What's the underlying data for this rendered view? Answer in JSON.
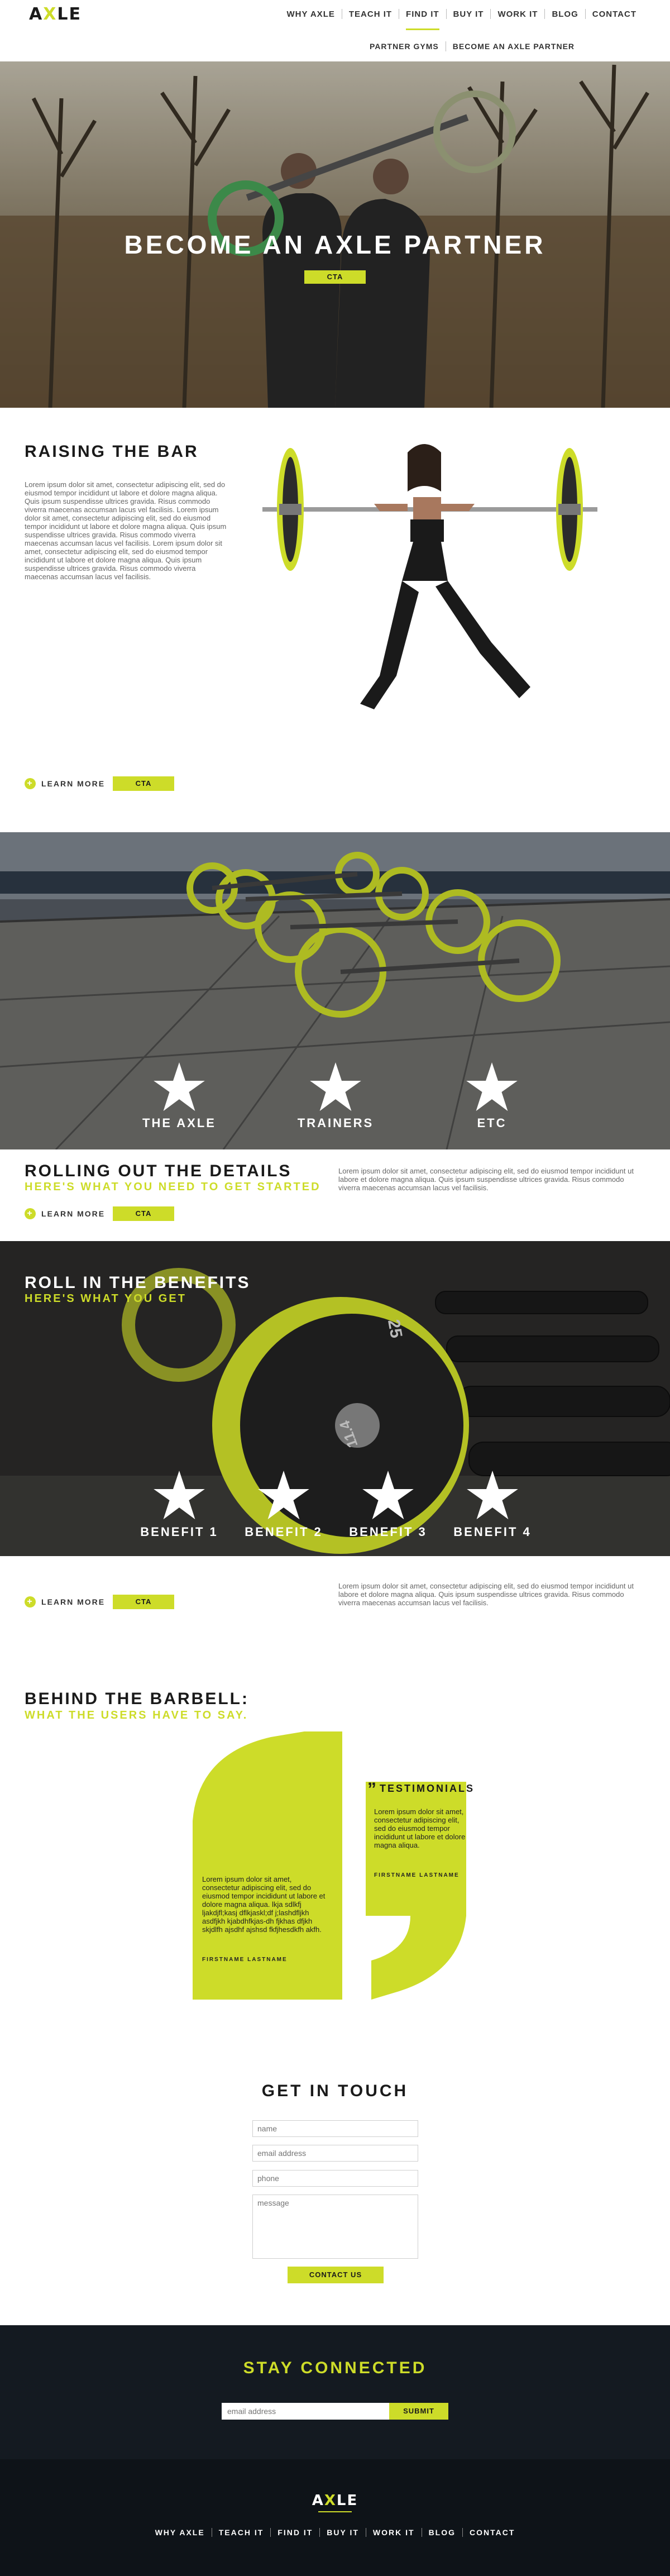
{
  "brand": {
    "logo_prefix": "A",
    "logo_x": "X",
    "logo_suffix": "LE",
    "accent": "#cddc29",
    "dark": "#141a21"
  },
  "nav": {
    "items": [
      "WHY AXLE",
      "TEACH IT",
      "FIND IT",
      "BUY IT",
      "WORK IT",
      "BLOG",
      "CONTACT"
    ],
    "active": "FIND IT",
    "sub_items": [
      "PARTNER GYMS",
      "BECOME AN AXLE PARTNER"
    ]
  },
  "hero": {
    "title": "BECOME AN AXLE PARTNER",
    "cta": "CTA"
  },
  "raising": {
    "title": "RAISING THE BAR",
    "body": "Lorem ipsum dolor sit amet, consectetur adipiscing elit, sed do eiusmod tempor incididunt ut labore et dolore magna aliqua. Quis ipsum suspendisse ultrices gravida. Risus commodo viverra maecenas accumsan lacus vel facilisis. Lorem ipsum dolor sit amet, consectetur adipiscing elit, sed do eiusmod tempor incididunt ut labore et dolore magna aliqua. Quis ipsum suspendisse ultrices gravida. Risus commodo viverra maecenas accumsan lacus vel facilisis. Lorem ipsum dolor sit amet, consectetur adipiscing elit, sed do eiusmod tempor incididunt ut labore et dolore magna aliqua. Quis ipsum suspendisse ultrices gravida. Risus commodo viverra maecenas accumsan lacus vel facilisis.",
    "learn_more": "LEARN MORE",
    "cta": "CTA"
  },
  "stars1": [
    "THE AXLE",
    "TRAINERS",
    "ETC"
  ],
  "details": {
    "title": "ROLLING OUT THE DETAILS",
    "subtitle": "HERE'S WHAT YOU NEED TO GET STARTED",
    "body": "Lorem ipsum dolor sit amet, consectetur adipiscing elit, sed do eiusmod tempor incididunt ut labore et dolore magna aliqua. Quis ipsum suspendisse ultrices gravida. Risus commodo viverra maecenas accumsan lacus vel facilisis.",
    "learn_more": "LEARN MORE",
    "cta": "CTA"
  },
  "benefits": {
    "title": "ROLL IN THE BENEFITS",
    "subtitle": "HERE'S WHAT YOU GET",
    "items": [
      "BENEFIT 1",
      "BENEFIT 2",
      "BENEFIT 3",
      "BENEFIT 4"
    ],
    "plate_number_1": "25",
    "plate_number_2": "11.4",
    "body": "Lorem ipsum dolor sit amet, consectetur adipiscing elit, sed do eiusmod tempor incididunt ut labore et dolore magna aliqua. Quis ipsum suspendisse ultrices gravida. Risus commodo viverra maecenas accumsan lacus vel facilisis.",
    "learn_more": "LEARN MORE",
    "cta": "CTA"
  },
  "barbell": {
    "title": "BEHIND THE BARBELL:",
    "subtitle": "WHAT THE USERS HAVE TO SAY.",
    "testimonials_label": "TESTIMONIALS",
    "quote_left": "Lorem ipsum dolor sit amet, consectetur adipiscing elit, sed do eiusmod tempor incididunt ut labore et dolore magna aliqua. lkja sdlkfj ljakdjfl;kasj dflkjaskl;df j;lashdfljkh asdfjkh kjabdhfkjas-dh fjkhas dfjkh skjdlfh ajsdhf ajshsd fkfjhesdkfh akfh.",
    "name_left": "FIRSTNAME LASTNAME",
    "quote_right": "Lorem ipsum dolor sit amet, consectetur adipiscing elit, sed do eiusmod tempor incididunt ut labore et dolore magna aliqua.",
    "name_right": "FIRSTNAME LASTNAME"
  },
  "contact": {
    "title": "GET IN TOUCH",
    "name_placeholder": "name",
    "email_placeholder": "email address",
    "phone_placeholder": "phone",
    "message_placeholder": "message",
    "button": "CONTACT US"
  },
  "newsletter": {
    "title": "STAY CONNECTED",
    "placeholder": "email address",
    "button": "SUBMIT"
  },
  "footer": {
    "items": [
      "WHY AXLE",
      "TEACH IT",
      "FIND IT",
      "BUY IT",
      "WORK IT",
      "BLOG",
      "CONTACT"
    ]
  }
}
